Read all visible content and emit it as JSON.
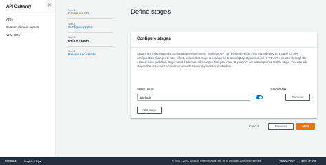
{
  "sidebar": {
    "title": "API Gateway",
    "items": [
      {
        "label": "APIs"
      },
      {
        "label": "Custom domain names"
      },
      {
        "label": "VPC links"
      }
    ]
  },
  "steps": [
    {
      "num": "Step 1",
      "label": "Create an API"
    },
    {
      "num": "Step 2",
      "label": "Configure routes"
    },
    {
      "num": "Step 3",
      "label": "Define stages"
    },
    {
      "num": "Step 4",
      "label": "Review and create"
    }
  ],
  "page": {
    "title": "Define stages"
  },
  "panel": {
    "title": "Configure stages",
    "description": "Stages are independently configurable environments that your API can be deployed to. You must deploy to a stage for API configuration changes to take effect, unless that stage is configured to autodeploy. By default, all HTTP APIs created through the console have a default stage named $default. All changes that you make to your API are autodeployed to that stage. You can add stages that represent environments such as development or production.",
    "stage_name_label": "Stage name",
    "auto_deploy_label": "Auto-deploy",
    "stage_name_value": "$default",
    "auto_deploy_on": true,
    "remove_label": "Remove",
    "add_stage_label": "Add stage"
  },
  "actions": {
    "cancel": "Cancel",
    "previous": "Previous",
    "next": "Next"
  },
  "footer": {
    "feedback": "Feedback",
    "language": "English (US)",
    "copyright": "© 2008 - 2020, Amazon Web Services, Inc. or its affiliates. All rights reserved.",
    "privacy": "Privacy Policy",
    "terms": "Terms of Use"
  },
  "colors": {
    "accent": "#ec7211",
    "link": "#0073bb",
    "footer_bg": "#232f3e"
  }
}
